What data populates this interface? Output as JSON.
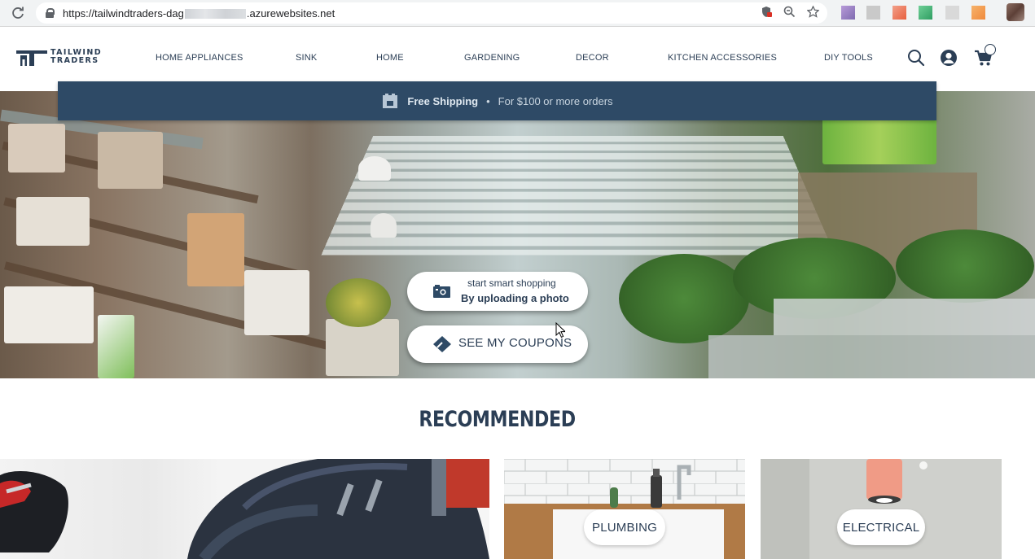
{
  "browser": {
    "url_prefix": "https://tailwindtraders-dag",
    "url_suffix": ".azurewebsites.net"
  },
  "brand": {
    "name_line1": "TAILWIND",
    "name_line2": "TRADERS",
    "color": "#2b3e55"
  },
  "nav": {
    "items": [
      "HOME APPLIANCES",
      "SINK",
      "HOME",
      "GARDENING",
      "DECOR",
      "KITCHEN ACCESSORIES",
      "DIY TOOLS"
    ]
  },
  "header_icons": [
    "search-icon",
    "user-icon",
    "cart-icon"
  ],
  "shipping": {
    "title": "Free Shipping",
    "separator": "•",
    "subtitle": "For $100 or more orders",
    "bg_color": "#2e4a66"
  },
  "hero": {
    "upload_small": "start smart shopping",
    "upload_big": "By uploading a photo",
    "coupons_label": "SEE MY COUPONS"
  },
  "recommended": {
    "heading": "RECOMMENDED",
    "cards": [
      {
        "label": ""
      },
      {
        "label": "PLUMBING"
      },
      {
        "label": "ELECTRICAL"
      }
    ]
  }
}
